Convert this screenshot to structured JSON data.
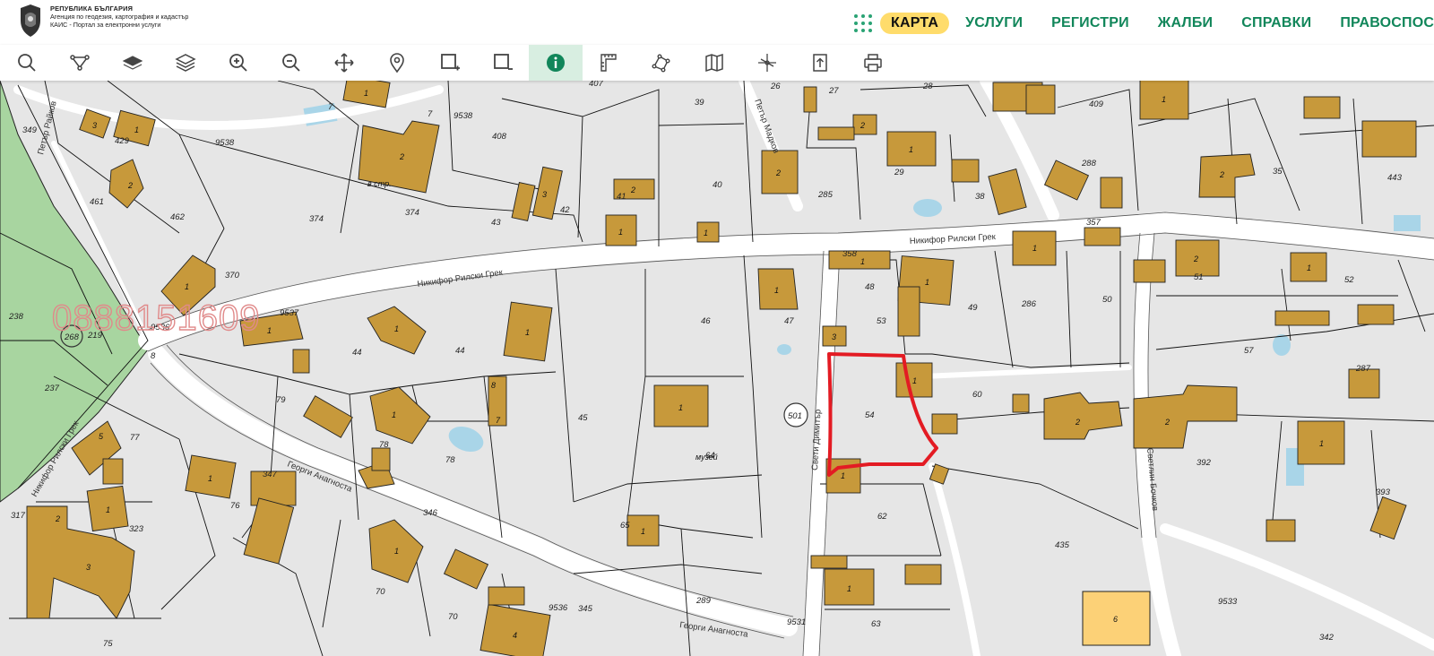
{
  "header": {
    "brand_line1": "РЕПУБЛИКА БЪЛГАРИЯ",
    "brand_line2": "Агенция по геодезия, картография и кадастър",
    "brand_line3": "КАИС - Портал за електронни услуги",
    "nav": [
      {
        "label": "КАРТА",
        "active": true
      },
      {
        "label": "УСЛУГИ"
      },
      {
        "label": "РЕГИСТРИ"
      },
      {
        "label": "ЖАЛБИ"
      },
      {
        "label": "СПРАВКИ"
      },
      {
        "label": "ПРАВОСПОСОБНИ"
      }
    ]
  },
  "toolbar": {
    "tools": [
      "search-icon",
      "route-icon",
      "layer-icon",
      "layers-icon",
      "zoom-in-icon",
      "zoom-out-icon",
      "pan-icon",
      "location-pin-icon",
      "select-area-add-icon",
      "select-area-remove-icon",
      "info-icon",
      "measure-icon",
      "polyline-icon",
      "map-icon",
      "coordinates-icon",
      "export-icon",
      "print-icon"
    ],
    "active": "info-icon"
  },
  "colors": {
    "accent": "#11865a",
    "active_nav": "#ffdc6b",
    "parcel_fill": "#e6e6e6",
    "building_fill": "#c7993b",
    "highlight_building": "#fcd177",
    "forest": "#a8d5a0",
    "water": "#a9d5e8",
    "outline": "#e31b23"
  },
  "map": {
    "watermark": "0888151609",
    "streets": {
      "s1": "Никифор Рилски Грек",
      "s2": "Никифор Рилски Грек",
      "s3": "Георги Анагноста",
      "s4": "Георги Анагноста",
      "s5": "Свети Димитър",
      "s6": "Светлин Бочков",
      "s7": "Петър Мадков",
      "s8": "Петър Райков",
      "s9": "Никифор Рилски Грек"
    },
    "parcels": [
      "349",
      "429",
      "461",
      "462",
      "9538",
      "7",
      "407",
      "39",
      "26",
      "27",
      "28",
      "409",
      "408",
      "374",
      "43",
      "42",
      "41",
      "40",
      "285",
      "29",
      "288",
      "38",
      "443",
      "35",
      "370",
      "9536",
      "9537",
      "9538",
      "238",
      "268",
      "219",
      "237",
      "77",
      "79",
      "78",
      "44",
      "45",
      "46",
      "47",
      "48",
      "53",
      "49",
      "286",
      "50",
      "51",
      "52",
      "57",
      "287",
      "60",
      "392",
      "393",
      "54",
      "501",
      "64",
      "62",
      "435",
      "65",
      "289",
      "9531",
      "63",
      "9533",
      "70",
      "75",
      "76",
      "323",
      "317",
      "347",
      "346",
      "345",
      "342",
      "357",
      "358",
      "374",
      "8",
      "40"
    ],
    "parcel_labels": {
      "p349": "349",
      "p429": "429",
      "p461": "461",
      "p462": "462",
      "p9538a": "9538",
      "p7a": "7",
      "p7b": "7",
      "p407": "407",
      "p39": "39",
      "p26": "26",
      "p27": "27",
      "p28": "28",
      "p409": "409",
      "p408": "408",
      "p374a": "374",
      "p374b": "374",
      "p43": "43",
      "p42": "42",
      "p41": "41",
      "p40": "40",
      "p285": "285",
      "p29": "29",
      "p288": "288",
      "p38": "38",
      "p443": "443",
      "p35": "35",
      "p370": "370",
      "p9536": "9536",
      "p9537": "9537",
      "p9538b": "9538",
      "p238": "238",
      "p268": "268",
      "p219": "219",
      "p237": "237",
      "p77": "77",
      "p79": "79",
      "p78a": "78",
      "p78b": "78",
      "p44a": "44",
      "p44b": "44",
      "p45": "45",
      "p46": "46",
      "p47": "47",
      "p48": "48",
      "p53": "53",
      "p49": "49",
      "p286": "286",
      "p50": "50",
      "p51": "51",
      "p52": "52",
      "p57": "57",
      "p287": "287",
      "p60": "60",
      "p392": "392",
      "p393": "393",
      "p54": "54",
      "p501": "501",
      "p64": "64",
      "p62": "62",
      "p435": "435",
      "p65": "65",
      "p289": "289",
      "p9531": "9531",
      "p63": "63",
      "p9533": "9533",
      "p70a": "70",
      "p70b": "70",
      "p75": "75",
      "p76": "76",
      "p323": "323",
      "p317": "317",
      "p347": "347",
      "p346": "346",
      "p345": "345",
      "p342": "342",
      "p357": "357",
      "p358": "358",
      "p9536b": "9536",
      "p8": "8"
    },
    "museum_label": "музей",
    "cottage_label": "в.стр.",
    "seal_a": "268",
    "seal_b": "501",
    "building_nums": [
      "1",
      "2",
      "3",
      "4",
      "5",
      "6",
      "7",
      "8"
    ]
  }
}
